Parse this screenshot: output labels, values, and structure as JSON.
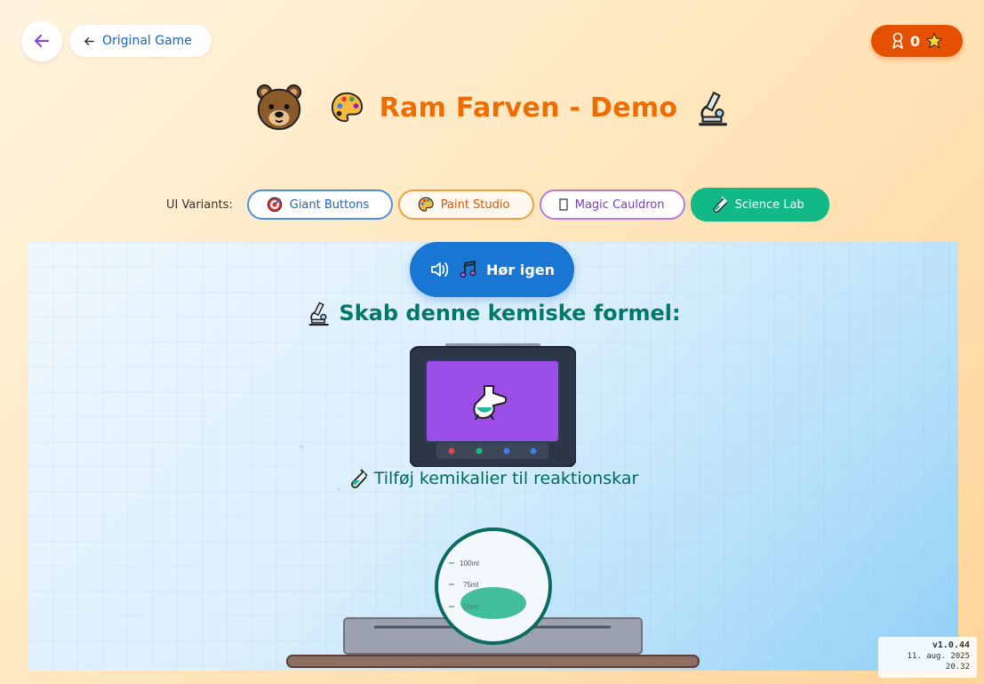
{
  "nav": {
    "original_game_label": "Original Game"
  },
  "score": {
    "value": "0"
  },
  "title": {
    "text": "Ram Farven - Demo"
  },
  "variants": {
    "label": "UI Variants:",
    "items": [
      {
        "label": "Giant Buttons",
        "icon": "target-icon"
      },
      {
        "label": "Paint Studio",
        "icon": "palette-icon"
      },
      {
        "label": "Magic Cauldron",
        "icon": "cauldron-icon"
      },
      {
        "label": "Science Lab",
        "icon": "test-tube-icon",
        "active": true
      }
    ]
  },
  "lab": {
    "replay_label": "Hør igen",
    "prompt": "Skab denne kemiske formel:",
    "add_text": "Tilføj kemikalier til reaktionskar",
    "beaker_marks": [
      "100ml",
      "75ml",
      "50ml"
    ],
    "monitor_color": "#9b4de8"
  },
  "version": {
    "number": "v1.0.44",
    "date": "11. aug. 2025",
    "time": "20.32"
  }
}
